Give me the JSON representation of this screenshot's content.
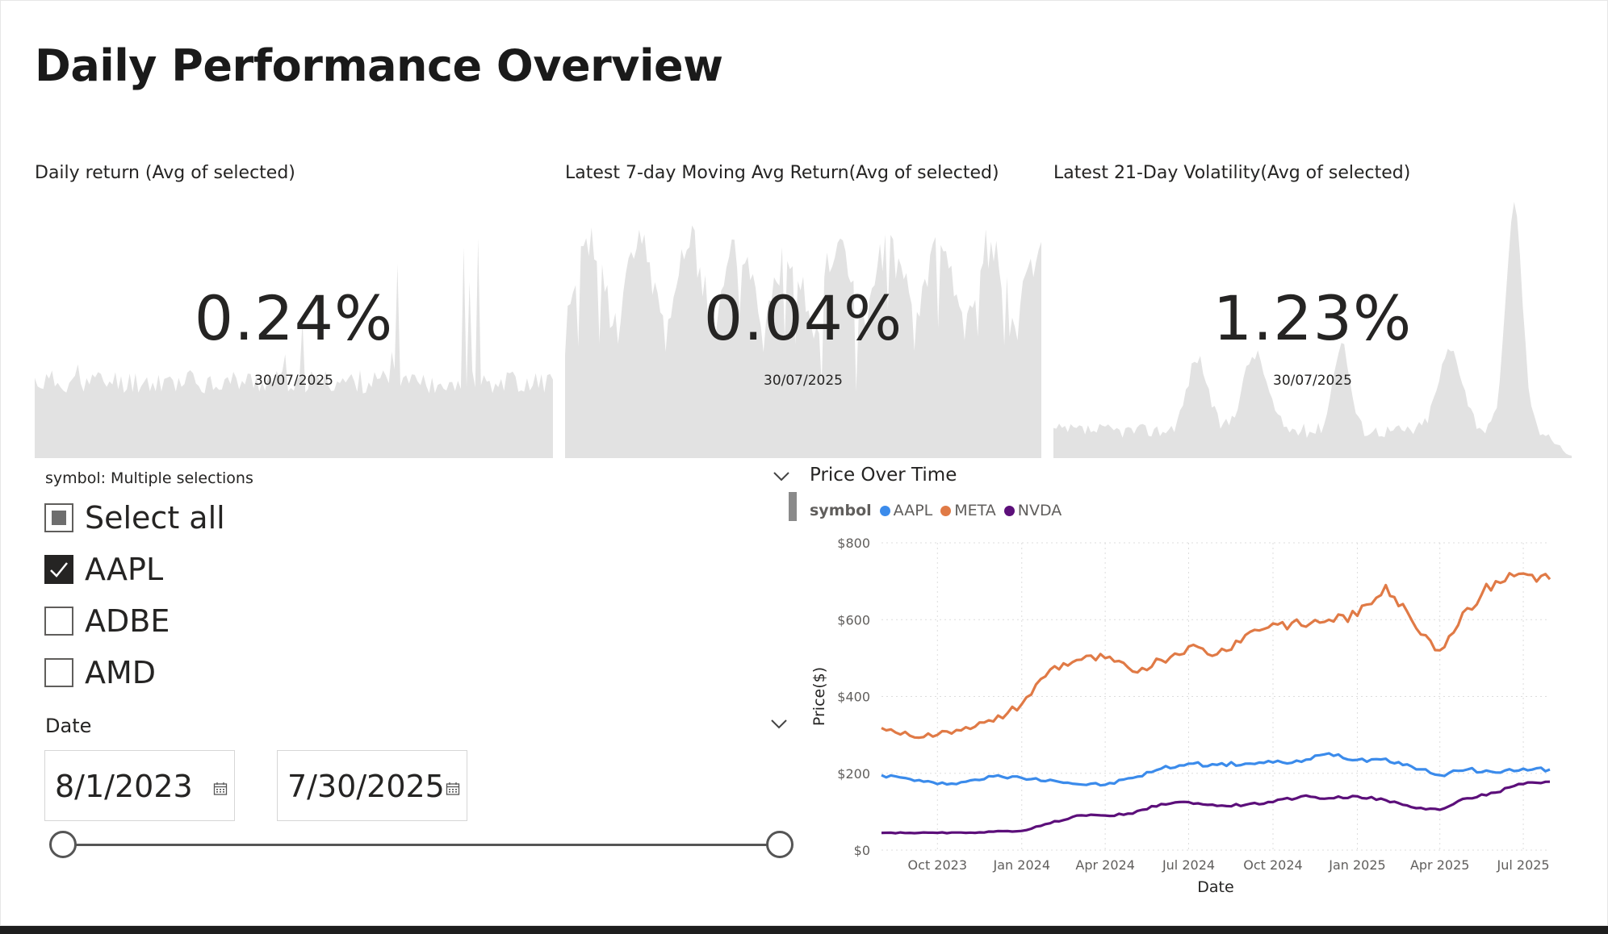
{
  "page_title": "Daily Performance Overview",
  "cards": [
    {
      "title": "Daily return (Avg of selected)",
      "value": "0.24%",
      "date": "30/07/2025"
    },
    {
      "title": "Latest 7-day Moving Avg Return(Avg of selected)",
      "value": "0.04%",
      "date": "30/07/2025"
    },
    {
      "title": "Latest 21-Day Volatility(Avg of selected)",
      "value": "1.23%",
      "date": "30/07/2025"
    }
  ],
  "symbol_slicer": {
    "header": "symbol: Multiple selections",
    "items": [
      {
        "label": "Select all",
        "state": "partial"
      },
      {
        "label": "AAPL",
        "state": "checked"
      },
      {
        "label": "ADBE",
        "state": "unchecked"
      },
      {
        "label": "AMD",
        "state": "unchecked"
      }
    ]
  },
  "date_slicer": {
    "label": "Date",
    "start": "8/1/2023",
    "end": "7/30/2025",
    "range_start_fraction": 0,
    "range_end_fraction": 1
  },
  "colors": {
    "AAPL": "#3b8beb",
    "META": "#e07a46",
    "NVDA": "#5c0f7a",
    "card_fill": "#e2e2e2"
  },
  "chart_data": {
    "type": "line",
    "title": "Price Over Time",
    "legend_title": "symbol",
    "legend_placement": "top-left",
    "xlabel": "Date",
    "ylabel": "Price($)",
    "ylim": [
      0,
      800
    ],
    "y_ticks": [
      "$0",
      "$200",
      "$400",
      "$600",
      "$800"
    ],
    "x_ticks": [
      "Oct 2023",
      "Jan 2024",
      "Apr 2024",
      "Jul 2024",
      "Oct 2024",
      "Jan 2025",
      "Apr 2025",
      "Jul 2025"
    ],
    "grid": true,
    "x": [
      "2023-08-01",
      "2023-09-01",
      "2023-10-01",
      "2023-11-01",
      "2023-12-01",
      "2024-01-01",
      "2024-02-01",
      "2024-03-01",
      "2024-04-01",
      "2024-05-01",
      "2024-06-01",
      "2024-07-01",
      "2024-08-01",
      "2024-09-01",
      "2024-10-01",
      "2024-11-01",
      "2024-12-01",
      "2025-01-01",
      "2025-02-01",
      "2025-03-01",
      "2025-04-01",
      "2025-05-01",
      "2025-06-01",
      "2025-07-01",
      "2025-07-30"
    ],
    "series": [
      {
        "name": "AAPL",
        "values": [
          195,
          185,
          172,
          178,
          192,
          188,
          183,
          172,
          170,
          188,
          212,
          225,
          222,
          225,
          228,
          230,
          252,
          235,
          238,
          218,
          195,
          210,
          202,
          212,
          210
        ]
      },
      {
        "name": "META",
        "values": [
          318,
          298,
          300,
          320,
          335,
          380,
          470,
          495,
          500,
          465,
          495,
          530,
          510,
          560,
          590,
          585,
          600,
          610,
          690,
          600,
          520,
          630,
          700,
          720,
          705
        ]
      },
      {
        "name": "NVDA",
        "values": [
          45,
          45,
          45,
          45,
          48,
          50,
          70,
          90,
          90,
          95,
          120,
          125,
          115,
          118,
          125,
          140,
          135,
          140,
          130,
          112,
          105,
          135,
          150,
          172,
          178
        ]
      }
    ]
  }
}
